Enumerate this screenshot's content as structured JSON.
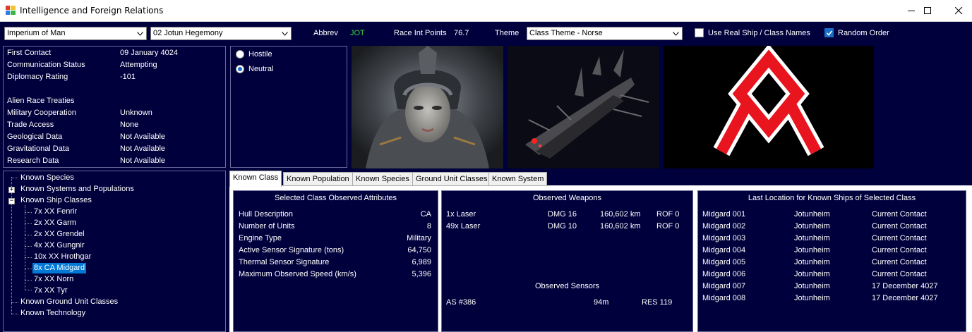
{
  "window": {
    "title": "Intelligence and Foreign Relations",
    "minimize": "—",
    "maximize": "☐",
    "close": "✕"
  },
  "toolbar": {
    "player_race": "Imperium of Man",
    "alien_race": "02 Jotun Hegemony",
    "abbrev_label": "Abbrev",
    "abbrev_value": "JOT",
    "race_int_label": "Race Int Points",
    "race_int_value": "76.7",
    "theme_label": "Theme",
    "theme_value": "Class Theme - Norse",
    "use_real_names_label": "Use Real Ship / Class Names",
    "use_real_names_checked": false,
    "random_order_label": "Random Order",
    "random_order_checked": true
  },
  "info": {
    "rows": [
      {
        "label": "First Contact",
        "value": "09 January 4024"
      },
      {
        "label": "Communication Status",
        "value": "Attempting"
      },
      {
        "label": "Diplomacy Rating",
        "value": "-101"
      }
    ],
    "treaties_header": "Alien Race Treaties",
    "treaties": [
      {
        "label": "Military Cooperation",
        "value": "Unknown"
      },
      {
        "label": "Trade Access",
        "value": "None"
      },
      {
        "label": "Geological Data",
        "value": "Not Available"
      },
      {
        "label": "Gravitational Data",
        "value": "Not Available"
      },
      {
        "label": "Research Data",
        "value": "Not Available"
      }
    ]
  },
  "stance": {
    "hostile": "Hostile",
    "neutral": "Neutral",
    "selected": "Neutral"
  },
  "tree": {
    "known_species": "Known Species",
    "known_systems": "Known Systems and Populations",
    "known_ship_classes": "Known Ship Classes",
    "classes": [
      "7x XX Fenrir",
      "2x XX Garm",
      "2x XX Grendel",
      "4x XX Gungnir",
      "10x XX Hrothgar",
      "8x CA Midgard",
      "7x XX Norn",
      "7x XX Tyr"
    ],
    "selected_class": "8x CA Midgard",
    "known_ground_units": "Known Ground Unit Classes",
    "known_technology": "Known Technology"
  },
  "tabs": [
    "Known Class",
    "Known Population",
    "Known Species",
    "Ground Unit Classes",
    "Known System"
  ],
  "active_tab": "Known Class",
  "class_attributes": {
    "title": "Selected Class Observed Attributes",
    "rows": [
      {
        "label": "Hull Description",
        "value": "CA"
      },
      {
        "label": "Number of Units",
        "value": "8"
      },
      {
        "label": "Engine Type",
        "value": "Military"
      },
      {
        "label": "Active Sensor Signature (tons)",
        "value": "64,750"
      },
      {
        "label": "Thermal Sensor Signature",
        "value": "6,989"
      },
      {
        "label": "Maximum Observed Speed (km/s)",
        "value": "5,396"
      }
    ]
  },
  "weapons": {
    "title": "Observed Weapons",
    "rows": [
      {
        "name": "1x Laser",
        "dmg": "DMG 16",
        "range": "160,602 km",
        "rof": "ROF 0"
      },
      {
        "name": "49x Laser",
        "dmg": "DMG 10",
        "range": "160,602 km",
        "rof": "ROF 0"
      }
    ],
    "sensors_title": "Observed Sensors",
    "sensors": [
      {
        "name": "AS #386",
        "range": "94m",
        "res": "RES 119"
      }
    ]
  },
  "locations": {
    "title": "Last Location for Known Ships of Selected Class",
    "rows": [
      {
        "ship": "Midgard 001",
        "system": "Jotunheim",
        "status": "Current Contact"
      },
      {
        "ship": "Midgard 002",
        "system": "Jotunheim",
        "status": "Current Contact"
      },
      {
        "ship": "Midgard 003",
        "system": "Jotunheim",
        "status": "Current Contact"
      },
      {
        "ship": "Midgard 004",
        "system": "Jotunheim",
        "status": "Current Contact"
      },
      {
        "ship": "Midgard 005",
        "system": "Jotunheim",
        "status": "Current Contact"
      },
      {
        "ship": "Midgard 006",
        "system": "Jotunheim",
        "status": "Current Contact"
      },
      {
        "ship": "Midgard 007",
        "system": "Jotunheim",
        "status": "17 December 4027"
      },
      {
        "ship": "Midgard 008",
        "system": "Jotunheim",
        "status": "17 December 4027"
      }
    ]
  },
  "colors": {
    "background": "#00003c",
    "accent": "#0078d7",
    "abbrev": "#3cd23c",
    "flag_red": "#e8141e"
  },
  "images": {
    "race_portrait": "race-portrait",
    "ship_image": "ship-image",
    "race_flag": "othala-rune-flag"
  }
}
